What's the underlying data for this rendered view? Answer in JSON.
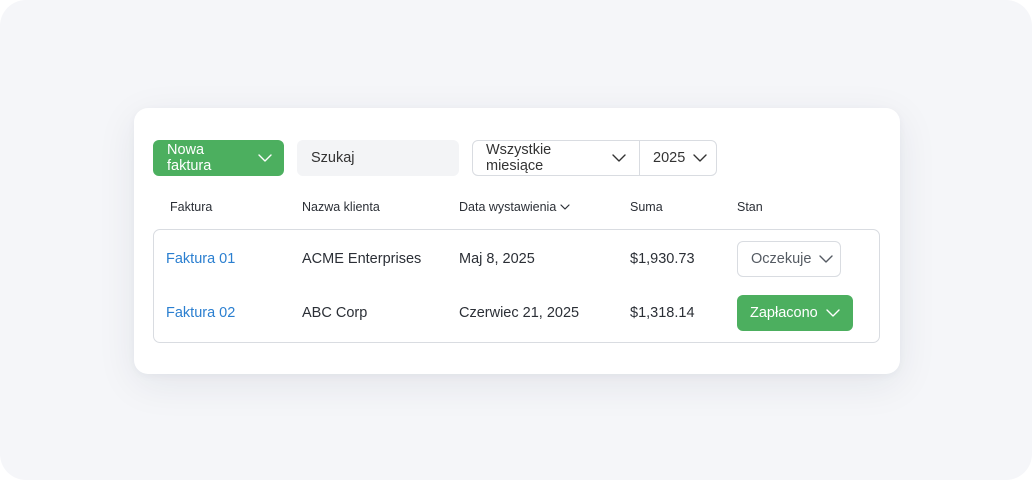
{
  "toolbar": {
    "new_invoice_label": "Nowa faktura",
    "search_value": "Szukaj",
    "month_filter_value": "Wszystkie miesiące",
    "year_filter_value": "2025"
  },
  "table": {
    "columns": [
      "Faktura",
      "Nazwa klienta",
      "Data wystawienia",
      "Suma",
      "Stan"
    ],
    "sorted_column": "Data wystawienia",
    "rows": [
      {
        "invoice": "Faktura 01",
        "client": "ACME Enterprises",
        "date": "Maj 8, 2025",
        "total": "$1,930.73",
        "status": "Oczekuje",
        "status_kind": "pending"
      },
      {
        "invoice": "Faktura 02",
        "client": "ABC Corp",
        "date": "Czerwiec 21, 2025",
        "total": "$1,318.14",
        "status": "Zapłacono",
        "status_kind": "paid"
      }
    ]
  },
  "icons": {
    "dropdown": "chevron-down-icon",
    "sort": "chevron-down-icon"
  },
  "colors": {
    "accent_green": "#4caf5f",
    "link_blue": "#2b7fd0",
    "border": "#d9dce1",
    "background": "#f5f6f9"
  }
}
